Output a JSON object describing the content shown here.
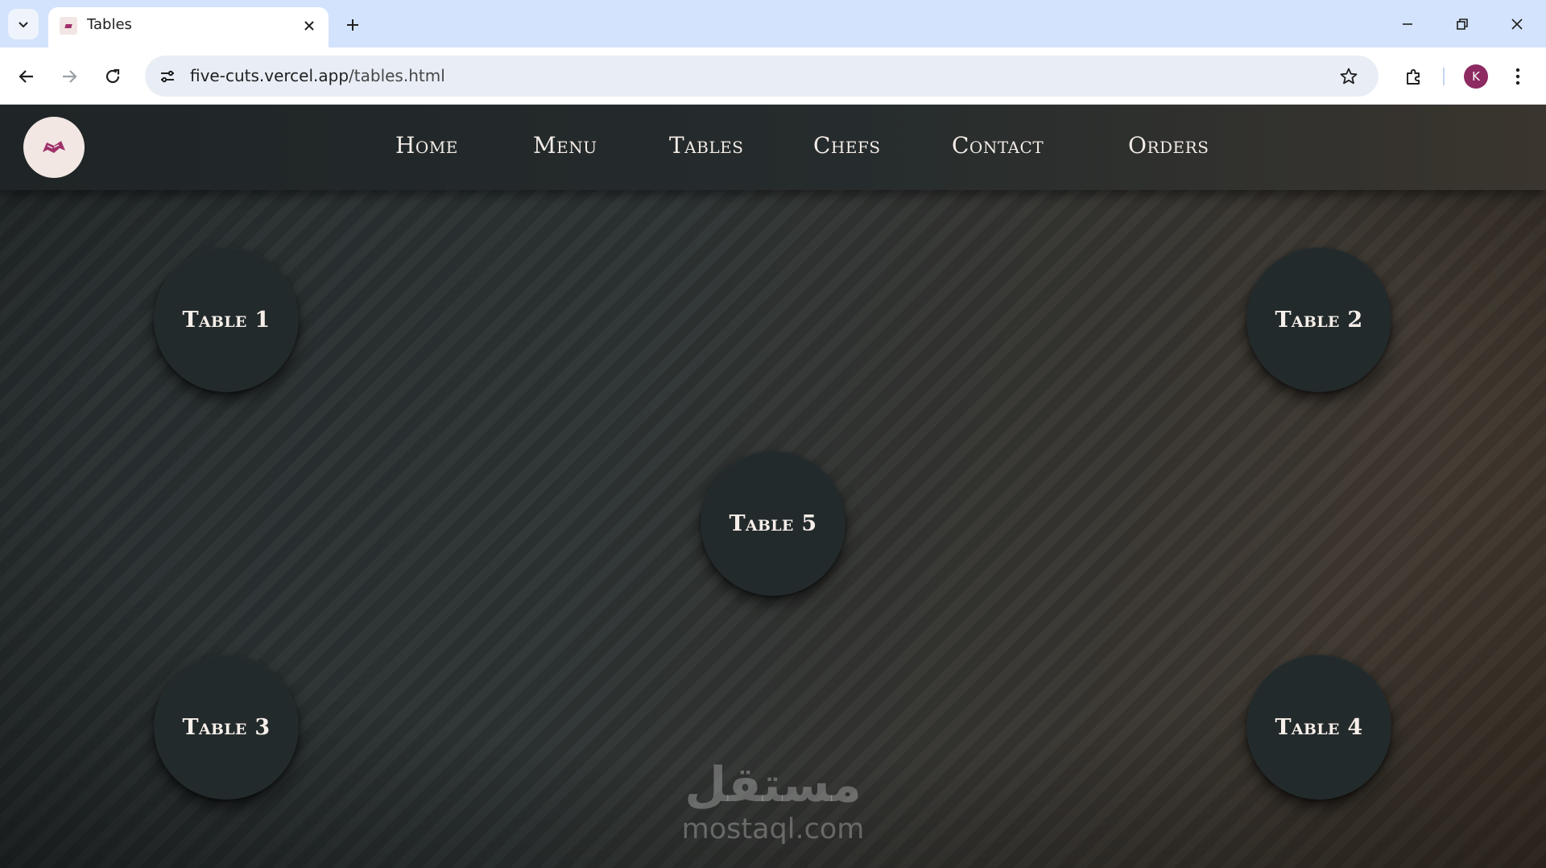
{
  "browser": {
    "tab": {
      "title": "Tables"
    },
    "address": {
      "host": "five-cuts.vercel.app",
      "path": "/tables.html"
    },
    "profile_initial": "K",
    "icons": {
      "tab_list": "chevron-down-icon",
      "tab_close": "close-icon",
      "new_tab": "plus-icon",
      "minimize": "minimize-icon",
      "restore": "restore-icon",
      "close_window": "close-icon",
      "back": "back-arrow-icon",
      "forward": "forward-arrow-icon",
      "reload": "reload-icon",
      "site_info": "tune-icon",
      "bookmark": "star-icon",
      "extensions": "puzzle-icon",
      "menu": "more-vert-icon"
    }
  },
  "site": {
    "logo": "restaurant-logo",
    "nav": [
      "Home",
      "Menu",
      "Tables",
      "Chefs",
      "Contact",
      "Orders"
    ],
    "tables": [
      "Table 1",
      "Table 2",
      "Table 3",
      "Table 4",
      "Table 5"
    ]
  },
  "watermark": {
    "arabic": "مستقل",
    "latin": "mostaql.com"
  },
  "colors": {
    "accent": "#8c2a61",
    "tab_strip": "#d3e3fd",
    "header_bg": "#1f2526",
    "table_bg": "#232a2b",
    "nav_text": "#f2ebe6"
  }
}
